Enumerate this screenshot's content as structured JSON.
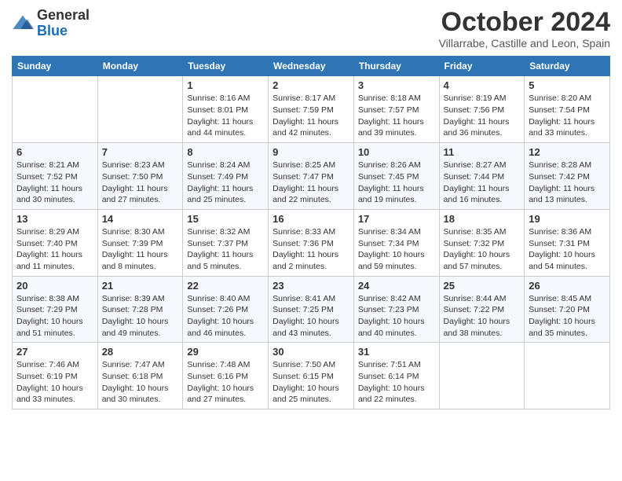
{
  "logo": {
    "text_general": "General",
    "text_blue": "Blue"
  },
  "header": {
    "month_title": "October 2024",
    "subtitle": "Villarrabe, Castille and Leon, Spain"
  },
  "days_of_week": [
    "Sunday",
    "Monday",
    "Tuesday",
    "Wednesday",
    "Thursday",
    "Friday",
    "Saturday"
  ],
  "weeks": [
    [
      {
        "day": "",
        "info": ""
      },
      {
        "day": "",
        "info": ""
      },
      {
        "day": "1",
        "info": "Sunrise: 8:16 AM\nSunset: 8:01 PM\nDaylight: 11 hours and 44 minutes."
      },
      {
        "day": "2",
        "info": "Sunrise: 8:17 AM\nSunset: 7:59 PM\nDaylight: 11 hours and 42 minutes."
      },
      {
        "day": "3",
        "info": "Sunrise: 8:18 AM\nSunset: 7:57 PM\nDaylight: 11 hours and 39 minutes."
      },
      {
        "day": "4",
        "info": "Sunrise: 8:19 AM\nSunset: 7:56 PM\nDaylight: 11 hours and 36 minutes."
      },
      {
        "day": "5",
        "info": "Sunrise: 8:20 AM\nSunset: 7:54 PM\nDaylight: 11 hours and 33 minutes."
      }
    ],
    [
      {
        "day": "6",
        "info": "Sunrise: 8:21 AM\nSunset: 7:52 PM\nDaylight: 11 hours and 30 minutes."
      },
      {
        "day": "7",
        "info": "Sunrise: 8:23 AM\nSunset: 7:50 PM\nDaylight: 11 hours and 27 minutes."
      },
      {
        "day": "8",
        "info": "Sunrise: 8:24 AM\nSunset: 7:49 PM\nDaylight: 11 hours and 25 minutes."
      },
      {
        "day": "9",
        "info": "Sunrise: 8:25 AM\nSunset: 7:47 PM\nDaylight: 11 hours and 22 minutes."
      },
      {
        "day": "10",
        "info": "Sunrise: 8:26 AM\nSunset: 7:45 PM\nDaylight: 11 hours and 19 minutes."
      },
      {
        "day": "11",
        "info": "Sunrise: 8:27 AM\nSunset: 7:44 PM\nDaylight: 11 hours and 16 minutes."
      },
      {
        "day": "12",
        "info": "Sunrise: 8:28 AM\nSunset: 7:42 PM\nDaylight: 11 hours and 13 minutes."
      }
    ],
    [
      {
        "day": "13",
        "info": "Sunrise: 8:29 AM\nSunset: 7:40 PM\nDaylight: 11 hours and 11 minutes."
      },
      {
        "day": "14",
        "info": "Sunrise: 8:30 AM\nSunset: 7:39 PM\nDaylight: 11 hours and 8 minutes."
      },
      {
        "day": "15",
        "info": "Sunrise: 8:32 AM\nSunset: 7:37 PM\nDaylight: 11 hours and 5 minutes."
      },
      {
        "day": "16",
        "info": "Sunrise: 8:33 AM\nSunset: 7:36 PM\nDaylight: 11 hours and 2 minutes."
      },
      {
        "day": "17",
        "info": "Sunrise: 8:34 AM\nSunset: 7:34 PM\nDaylight: 10 hours and 59 minutes."
      },
      {
        "day": "18",
        "info": "Sunrise: 8:35 AM\nSunset: 7:32 PM\nDaylight: 10 hours and 57 minutes."
      },
      {
        "day": "19",
        "info": "Sunrise: 8:36 AM\nSunset: 7:31 PM\nDaylight: 10 hours and 54 minutes."
      }
    ],
    [
      {
        "day": "20",
        "info": "Sunrise: 8:38 AM\nSunset: 7:29 PM\nDaylight: 10 hours and 51 minutes."
      },
      {
        "day": "21",
        "info": "Sunrise: 8:39 AM\nSunset: 7:28 PM\nDaylight: 10 hours and 49 minutes."
      },
      {
        "day": "22",
        "info": "Sunrise: 8:40 AM\nSunset: 7:26 PM\nDaylight: 10 hours and 46 minutes."
      },
      {
        "day": "23",
        "info": "Sunrise: 8:41 AM\nSunset: 7:25 PM\nDaylight: 10 hours and 43 minutes."
      },
      {
        "day": "24",
        "info": "Sunrise: 8:42 AM\nSunset: 7:23 PM\nDaylight: 10 hours and 40 minutes."
      },
      {
        "day": "25",
        "info": "Sunrise: 8:44 AM\nSunset: 7:22 PM\nDaylight: 10 hours and 38 minutes."
      },
      {
        "day": "26",
        "info": "Sunrise: 8:45 AM\nSunset: 7:20 PM\nDaylight: 10 hours and 35 minutes."
      }
    ],
    [
      {
        "day": "27",
        "info": "Sunrise: 7:46 AM\nSunset: 6:19 PM\nDaylight: 10 hours and 33 minutes."
      },
      {
        "day": "28",
        "info": "Sunrise: 7:47 AM\nSunset: 6:18 PM\nDaylight: 10 hours and 30 minutes."
      },
      {
        "day": "29",
        "info": "Sunrise: 7:48 AM\nSunset: 6:16 PM\nDaylight: 10 hours and 27 minutes."
      },
      {
        "day": "30",
        "info": "Sunrise: 7:50 AM\nSunset: 6:15 PM\nDaylight: 10 hours and 25 minutes."
      },
      {
        "day": "31",
        "info": "Sunrise: 7:51 AM\nSunset: 6:14 PM\nDaylight: 10 hours and 22 minutes."
      },
      {
        "day": "",
        "info": ""
      },
      {
        "day": "",
        "info": ""
      }
    ]
  ]
}
